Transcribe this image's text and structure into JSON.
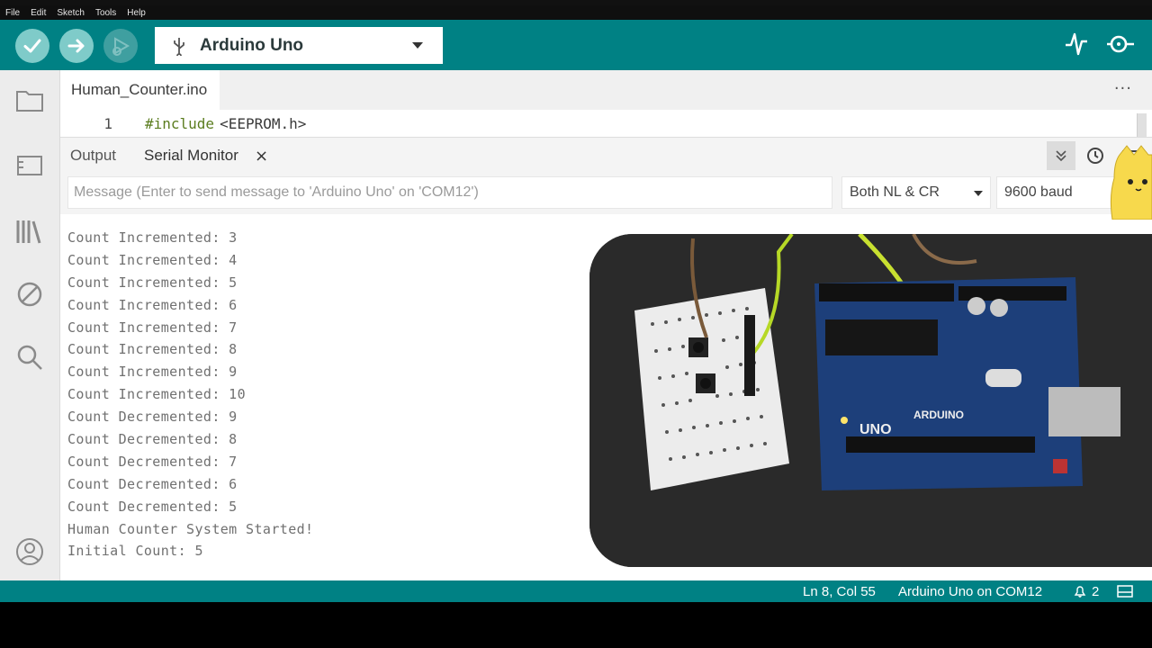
{
  "menu": [
    "File",
    "Edit",
    "Sketch",
    "Tools",
    "Help"
  ],
  "toolbar": {
    "verify_icon": "check-icon",
    "upload_icon": "arrow-right-icon",
    "debug_icon": "debug-icon",
    "board": "Arduino Uno",
    "serial_plotter_icon": "pulse-icon",
    "serial_monitor_icon": "monitor-icon"
  },
  "editor": {
    "file_tab": "Human_Counter.ino",
    "more": "···",
    "line_number": "1",
    "code_keyword": "#include",
    "code_rest": "<EEPROM.h>"
  },
  "panel": {
    "output_tab": "Output",
    "serial_tab": "Serial Monitor",
    "close": "×"
  },
  "serial": {
    "message_placeholder": "Message (Enter to send message to 'Arduino Uno' on 'COM12')",
    "line_ending": "Both NL & CR",
    "baud": "9600 baud",
    "lines": [
      "Count Incremented: 3",
      "Count Incremented: 4",
      "Count Incremented: 5",
      "Count Incremented: 6",
      "Count Incremented: 7",
      "Count Incremented: 8",
      "Count Incremented: 9",
      "Count Incremented: 10",
      "Count Decremented: 9",
      "Count Decremented: 8",
      "Count Decremented: 7",
      "Count Decremented: 6",
      "Count Decremented: 5",
      "Human Counter System Started!",
      "Initial Count: 5"
    ]
  },
  "status": {
    "position": "Ln 8, Col 55",
    "board_port": "Arduino Uno on COM12",
    "notifications": "2"
  },
  "colors": {
    "teal": "#008184",
    "button_light": "#7fcbc9"
  }
}
